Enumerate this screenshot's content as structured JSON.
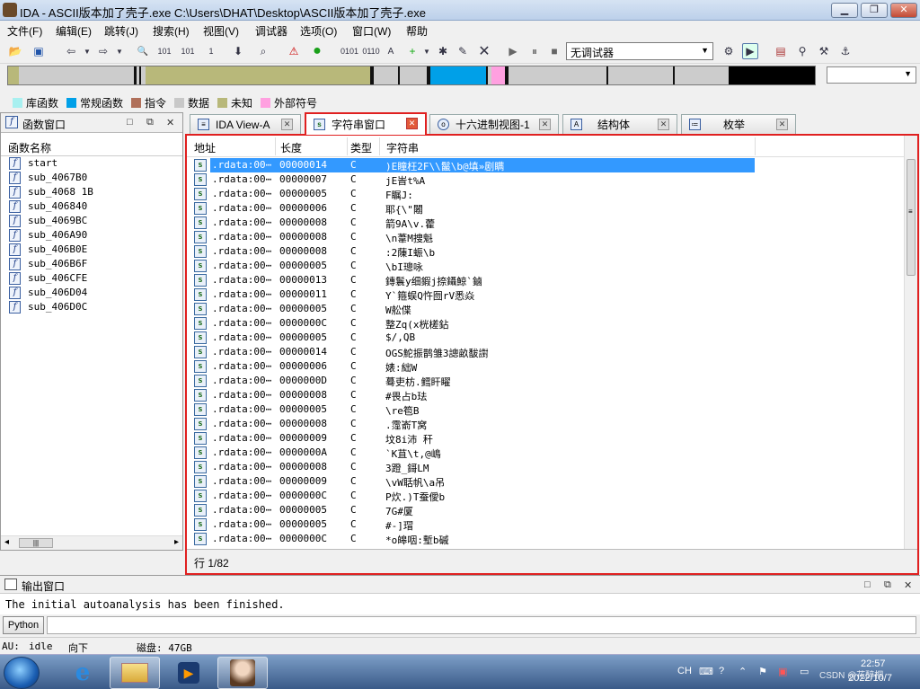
{
  "window": {
    "title": "IDA - ASCII版本加了壳子.exe C:\\Users\\DHAT\\Desktop\\ASCII版本加了壳子.exe"
  },
  "menu": [
    "文件(F)",
    "编辑(E)",
    "跳转(J)",
    "搜索(H)",
    "视图(V)",
    "调试器",
    "选项(O)",
    "窗口(W)",
    "帮助"
  ],
  "toolbar": {
    "debugger_select": "无调试器"
  },
  "legend": [
    {
      "label": "库函数",
      "color": "#a8f0f0"
    },
    {
      "label": "常规函数",
      "color": "#00a0e8"
    },
    {
      "label": "指令",
      "color": "#b0705a"
    },
    {
      "label": "数据",
      "color": "#c8c8c8"
    },
    {
      "label": "未知",
      "color": "#b8b87a"
    },
    {
      "label": "外部符号",
      "color": "#ffa0e0"
    }
  ],
  "functions_panel": {
    "title": "函数窗口",
    "column": "函数名称",
    "items": [
      "start",
      "sub_4067B0",
      "sub_4068 1B",
      "sub_406840",
      "sub_4069BC",
      "sub_406A90",
      "sub_406B0E",
      "sub_406B6F",
      "sub_406CFE",
      "sub_406D04",
      "sub_406D0C"
    ]
  },
  "tabs": [
    {
      "label": "IDA View-A",
      "icon": "ida-view-icon"
    },
    {
      "label": "字符串窗口",
      "icon": "strings-icon"
    },
    {
      "label": "十六进制视图-1",
      "icon": "hex-view-icon"
    },
    {
      "label": "结构体",
      "icon": "structures-icon"
    },
    {
      "label": "枚举",
      "icon": "enums-icon"
    }
  ],
  "strings_window": {
    "columns": [
      "地址",
      "长度",
      "类型",
      "字符串"
    ],
    "rows": [
      {
        "addr": ".rdata:00⋯",
        "len": "00000014",
        "type": "C",
        "str": ")E瞳枉2F\\\\鬣\\b@填»剧瞒"
      },
      {
        "addr": ".rdata:00⋯",
        "len": "00000007",
        "type": "C",
        "str": "jE峕t%A"
      },
      {
        "addr": ".rdata:00⋯",
        "len": "00000005",
        "type": "C",
        "str": "F瞩J:"
      },
      {
        "addr": ".rdata:00⋯",
        "len": "00000006",
        "type": "C",
        "str": "耶{\\\"闂"
      },
      {
        "addr": ".rdata:00⋯",
        "len": "00000008",
        "type": "C",
        "str": "箭9A\\v.藿"
      },
      {
        "addr": ".rdata:00⋯",
        "len": "00000008",
        "type": "C",
        "str": "\\n葦M捜魁"
      },
      {
        "addr": ".rdata:00⋯",
        "len": "00000008",
        "type": "C",
        "str": ":2蔯I蜄\\b"
      },
      {
        "addr": ".rdata:00⋯",
        "len": "00000005",
        "type": "C",
        "str": "\\bI璁咏"
      },
      {
        "addr": ".rdata:00⋯",
        "len": "00000013",
        "type": "C",
        "str": "鏄鬟y细鍜j捺鑷鯨`鏀"
      },
      {
        "addr": ".rdata:00⋯",
        "len": "00000011",
        "type": "C",
        "str": "Y`箍蜈Q忤囫rV悉焱"
      },
      {
        "addr": ".rdata:00⋯",
        "len": "00000005",
        "type": "C",
        "str": "W舩偞"
      },
      {
        "addr": ".rdata:00⋯",
        "len": "0000000C",
        "type": "C",
        "str": "整Zq(x桄槎鉆"
      },
      {
        "addr": ".rdata:00⋯",
        "len": "00000005",
        "type": "C",
        "str": "$/,QB"
      },
      {
        "addr": ".rdata:00⋯",
        "len": "00000014",
        "type": "C",
        "str": "OGS鮀振鹊雏3謥畝馛譵"
      },
      {
        "addr": ".rdata:00⋯",
        "len": "00000006",
        "type": "C",
        "str": "婊:絀W"
      },
      {
        "addr": ".rdata:00⋯",
        "len": "0000000D",
        "type": "C",
        "str": "蓦吏枋.鳕盰矅"
      },
      {
        "addr": ".rdata:00⋯",
        "len": "00000008",
        "type": "C",
        "str": "#畏占b珐"
      },
      {
        "addr": ".rdata:00⋯",
        "len": "00000005",
        "type": "C",
        "str": "\\re笣B"
      },
      {
        "addr": ".rdata:00⋯",
        "len": "00000008",
        "type": "C",
        "str": ".霪嵛T窝"
      },
      {
        "addr": ".rdata:00⋯",
        "len": "00000009",
        "type": "C",
        "str": "坟8i沛 秆"
      },
      {
        "addr": ".rdata:00⋯",
        "len": "0000000A",
        "type": "C",
        "str": "`K苴\\t,@嶋"
      },
      {
        "addr": ".rdata:00⋯",
        "len": "00000008",
        "type": "C",
        "str": "3蹬_鎶LM"
      },
      {
        "addr": ".rdata:00⋯",
        "len": "00000009",
        "type": "C",
        "str": "\\vW聒帆\\a吊"
      },
      {
        "addr": ".rdata:00⋯",
        "len": "0000000C",
        "type": "C",
        "str": " P炊.)T蚕僾b"
      },
      {
        "addr": ".rdata:00⋯",
        "len": "00000005",
        "type": "C",
        "str": "7G#厦"
      },
      {
        "addr": ".rdata:00⋯",
        "len": "00000005",
        "type": "C",
        "str": "#-]瑁"
      },
      {
        "addr": ".rdata:00⋯",
        "len": "0000000C",
        "type": "C",
        "str": "*o皞咽:塹b磩"
      }
    ],
    "status": "行 1/82"
  },
  "output": {
    "title": "输出窗口",
    "text": "The initial autoanalysis has been finished."
  },
  "python_button": "Python",
  "statusbar": {
    "au": "AU:",
    "state": "idle",
    "direction": "向下",
    "disk": "磁盘: 47GB"
  },
  "taskbar": {
    "lang": "CH",
    "time": "22:57",
    "date": "2022/10/7",
    "watermark": "CSDN @花醉桐"
  }
}
